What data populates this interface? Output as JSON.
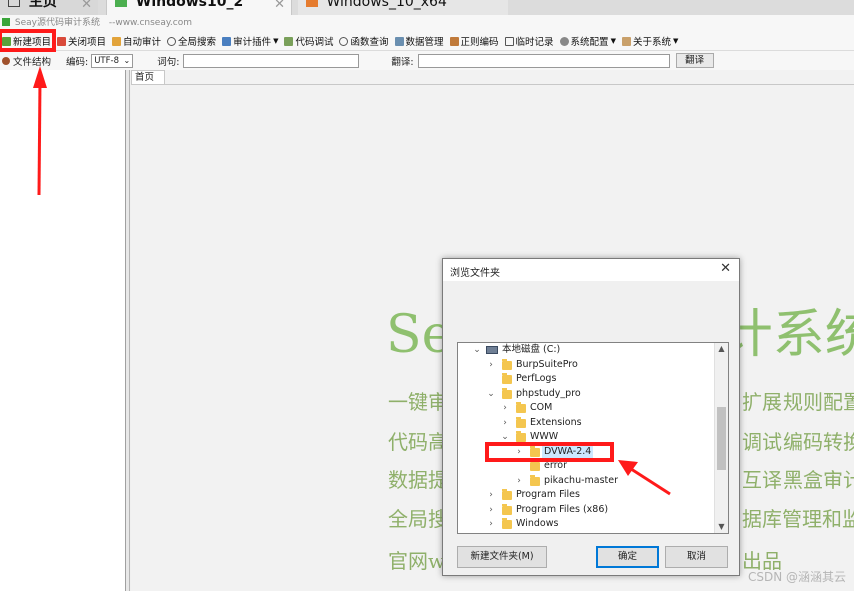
{
  "browser_tabs": [
    {
      "label": "主页"
    },
    {
      "label": "Windows10_2"
    },
    {
      "label": "Windows_10_x64"
    }
  ],
  "app": {
    "title": "Seay源代码审计系统",
    "website": "--www.cnseay.com"
  },
  "toolbar": {
    "items": [
      {
        "label": "新建项目",
        "icon": "new-project-icon"
      },
      {
        "label": "关闭项目",
        "icon": "close-project-icon"
      },
      {
        "label": "自动审计",
        "icon": "auto-audit-icon"
      },
      {
        "label": "全局搜索",
        "icon": "global-search-icon"
      },
      {
        "label": "审计插件",
        "icon": "plugin-icon",
        "dropdown": true
      },
      {
        "label": "代码调试",
        "icon": "debug-icon"
      },
      {
        "label": "函数查询",
        "icon": "function-search-icon"
      },
      {
        "label": "数据管理",
        "icon": "data-manage-icon"
      },
      {
        "label": "正则编码",
        "icon": "regex-encode-icon"
      },
      {
        "label": "临时记录",
        "icon": "temp-record-icon"
      },
      {
        "label": "系统配置",
        "icon": "settings-icon",
        "dropdown": true
      },
      {
        "label": "关于系统",
        "icon": "about-icon",
        "dropdown": true
      }
    ]
  },
  "row2": {
    "file_structure_label": "文件结构",
    "encoding_label": "编码:",
    "encoding_value": "UTF-8",
    "word_label": "词句:",
    "translate_label": "翻译:",
    "translate_button": "翻译"
  },
  "main": {
    "home_tab": "首页",
    "big_title": "Seay源代码审计系统",
    "feature_lines": [
      "一键审计",
      "扩展",
      "规则配置",
      "代码高亮",
      "调试",
      "编码转换",
      "数据提交",
      "互译",
      "黑盒审计",
      "全局搜索",
      "据库管理和监",
      "官网www",
      "出品"
    ]
  },
  "dialog": {
    "title": "浏览文件夹",
    "tree": [
      {
        "label": "本地磁盘 (C:)",
        "level": 0,
        "arrow": "down",
        "type": "drive"
      },
      {
        "label": "BurpSuitePro",
        "level": 1,
        "arrow": "right",
        "type": "folder"
      },
      {
        "label": "PerfLogs",
        "level": 1,
        "arrow": "",
        "type": "folder"
      },
      {
        "label": "phpstudy_pro",
        "level": 1,
        "arrow": "down",
        "type": "folder"
      },
      {
        "label": "COM",
        "level": 2,
        "arrow": "right",
        "type": "folder"
      },
      {
        "label": "Extensions",
        "level": 2,
        "arrow": "right",
        "type": "folder"
      },
      {
        "label": "WWW",
        "level": 2,
        "arrow": "down",
        "type": "folder"
      },
      {
        "label": "DVWA-2.4",
        "level": 3,
        "arrow": "right",
        "type": "folder",
        "selected": true
      },
      {
        "label": "error",
        "level": 3,
        "arrow": "",
        "type": "folder"
      },
      {
        "label": "pikachu-master",
        "level": 3,
        "arrow": "right",
        "type": "folder"
      },
      {
        "label": "Program Files",
        "level": 1,
        "arrow": "right",
        "type": "folder"
      },
      {
        "label": "Program Files (x86)",
        "level": 1,
        "arrow": "right",
        "type": "folder"
      },
      {
        "label": "Windows",
        "level": 1,
        "arrow": "right",
        "type": "folder"
      }
    ],
    "new_folder_button": "新建文件夹(M)",
    "ok_button": "确定",
    "cancel_button": "取消"
  },
  "watermark": "CSDN @涵涵其云",
  "colors": {
    "annotation_red": "#ff1a1a",
    "title_green": "#8fc06f",
    "selection_blue": "#cce8ff"
  }
}
